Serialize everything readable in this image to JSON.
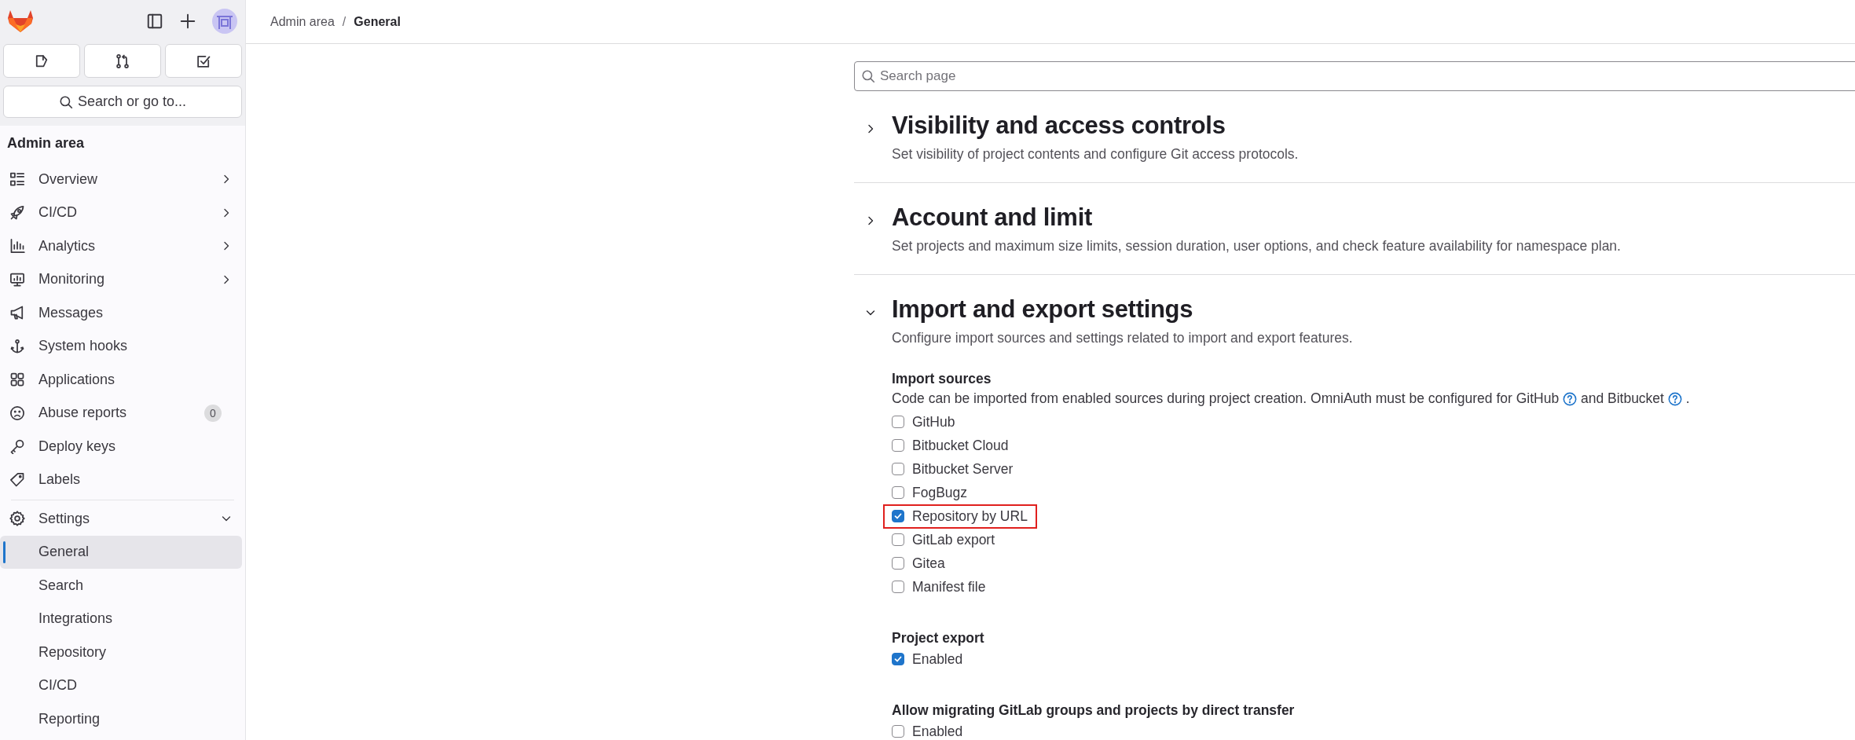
{
  "breadcrumb_separator": "/",
  "breadcrumbs": [
    {
      "label": "Admin area",
      "current": false
    },
    {
      "label": "General",
      "current": true
    }
  ],
  "sidebar": {
    "search": {
      "placeholder": "Search or go to..."
    },
    "title": "Admin area",
    "items": [
      {
        "label": "Overview",
        "expanded": false
      },
      {
        "label": "CI/CD",
        "expanded": false
      },
      {
        "label": "Analytics",
        "expanded": false
      },
      {
        "label": "Monitoring",
        "expanded": false
      },
      {
        "label": "Messages"
      },
      {
        "label": "System hooks"
      },
      {
        "label": "Applications"
      },
      {
        "label": "Abuse reports",
        "badge": "0"
      },
      {
        "label": "Deploy keys"
      },
      {
        "label": "Labels"
      },
      {
        "label": "Settings",
        "expanded": true,
        "children": [
          {
            "label": "General",
            "selected": true
          },
          {
            "label": "Search",
            "selected": false
          },
          {
            "label": "Integrations",
            "selected": false
          },
          {
            "label": "Repository",
            "selected": false
          },
          {
            "label": "CI/CD",
            "selected": false
          },
          {
            "label": "Reporting",
            "selected": false
          }
        ]
      }
    ]
  },
  "search": {
    "placeholder": "Search page"
  },
  "sections": [
    {
      "title": "Visibility and access controls",
      "description": "Set visibility of project contents and configure Git access protocols.",
      "expanded": false
    },
    {
      "title": "Account and limit",
      "description": "Set projects and maximum size limits, session duration, user options, and check feature availability for namespace plan.",
      "expanded": false
    },
    {
      "title": "Import and export settings",
      "description": "Configure import sources and settings related to import and export features.",
      "expanded": true,
      "groups": [
        {
          "title": "Import sources",
          "description": [
            "Code can be imported from enabled sources during project creation. OmniAuth must be configured for GitHub",
            "and Bitbucket",
            "."
          ],
          "options": [
            {
              "label": "GitHub",
              "checked": false,
              "highlighted": false
            },
            {
              "label": "Bitbucket Cloud",
              "checked": false,
              "highlighted": false
            },
            {
              "label": "Bitbucket Server",
              "checked": false,
              "highlighted": false
            },
            {
              "label": "FogBugz",
              "checked": false,
              "highlighted": false
            },
            {
              "label": "Repository by URL",
              "checked": true,
              "highlighted": true
            },
            {
              "label": "GitLab export",
              "checked": false,
              "highlighted": false
            },
            {
              "label": "Gitea",
              "checked": false,
              "highlighted": false
            },
            {
              "label": "Manifest file",
              "checked": false,
              "highlighted": false
            }
          ]
        },
        {
          "title": "Project export",
          "options": [
            {
              "label": "Enabled",
              "checked": true,
              "highlighted": false
            }
          ]
        },
        {
          "title": "Allow migrating GitLab groups and projects by direct transfer",
          "options": [
            {
              "label": "Enabled",
              "checked": false,
              "highlighted": false
            }
          ]
        }
      ]
    }
  ]
}
